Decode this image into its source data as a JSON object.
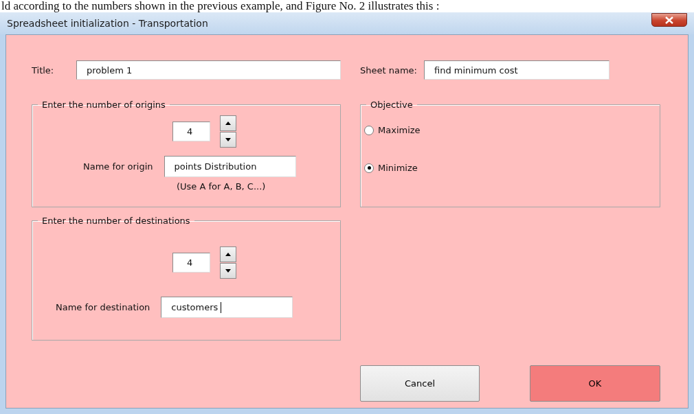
{
  "document_text": "ld according to the numbers shown in the previous example, and Figure No. 2 illustrates this :",
  "window": {
    "title": "Spreadsheet initialization - Transportation"
  },
  "title_field": {
    "label": "Title:",
    "value": "problem 1"
  },
  "sheet_name_field": {
    "label": "Sheet name:",
    "value": "find minimum cost"
  },
  "origins": {
    "legend": "Enter the number of origins",
    "count": "4",
    "name_label": "Name for origin",
    "name_value": "points Distribution",
    "hint": "(Use A for A, B, C...)",
    "focused": false
  },
  "destinations": {
    "legend": "Enter the number of destinations",
    "count": "4",
    "name_label": "Name for destination",
    "name_value": "customers",
    "focused": true
  },
  "objective": {
    "legend": "Objective",
    "options": [
      {
        "label": "Maximize",
        "selected": false
      },
      {
        "label": "Minimize",
        "selected": true
      }
    ]
  },
  "buttons": [
    {
      "label": "Cancel",
      "kind": "secondary"
    },
    {
      "label": "OK",
      "kind": "primary"
    }
  ]
}
